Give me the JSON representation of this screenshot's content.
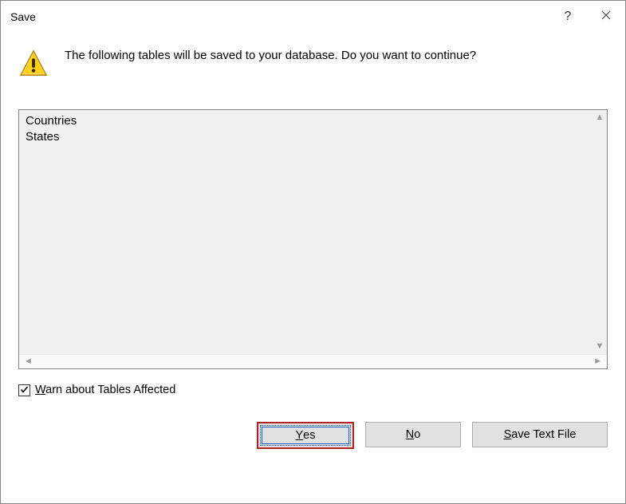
{
  "titlebar": {
    "title": "Save"
  },
  "dialog": {
    "message": "The following tables will be saved to your database. Do you want to continue?",
    "items": [
      "Countries",
      "States"
    ],
    "checkbox": {
      "checked": true,
      "label_pre": "",
      "label_u": "W",
      "label_post": "arn about Tables Affected"
    }
  },
  "buttons": {
    "yes_u": "Y",
    "yes_post": "es",
    "no_u": "N",
    "no_post": "o",
    "save_u": "S",
    "save_post": "ave Text File"
  }
}
